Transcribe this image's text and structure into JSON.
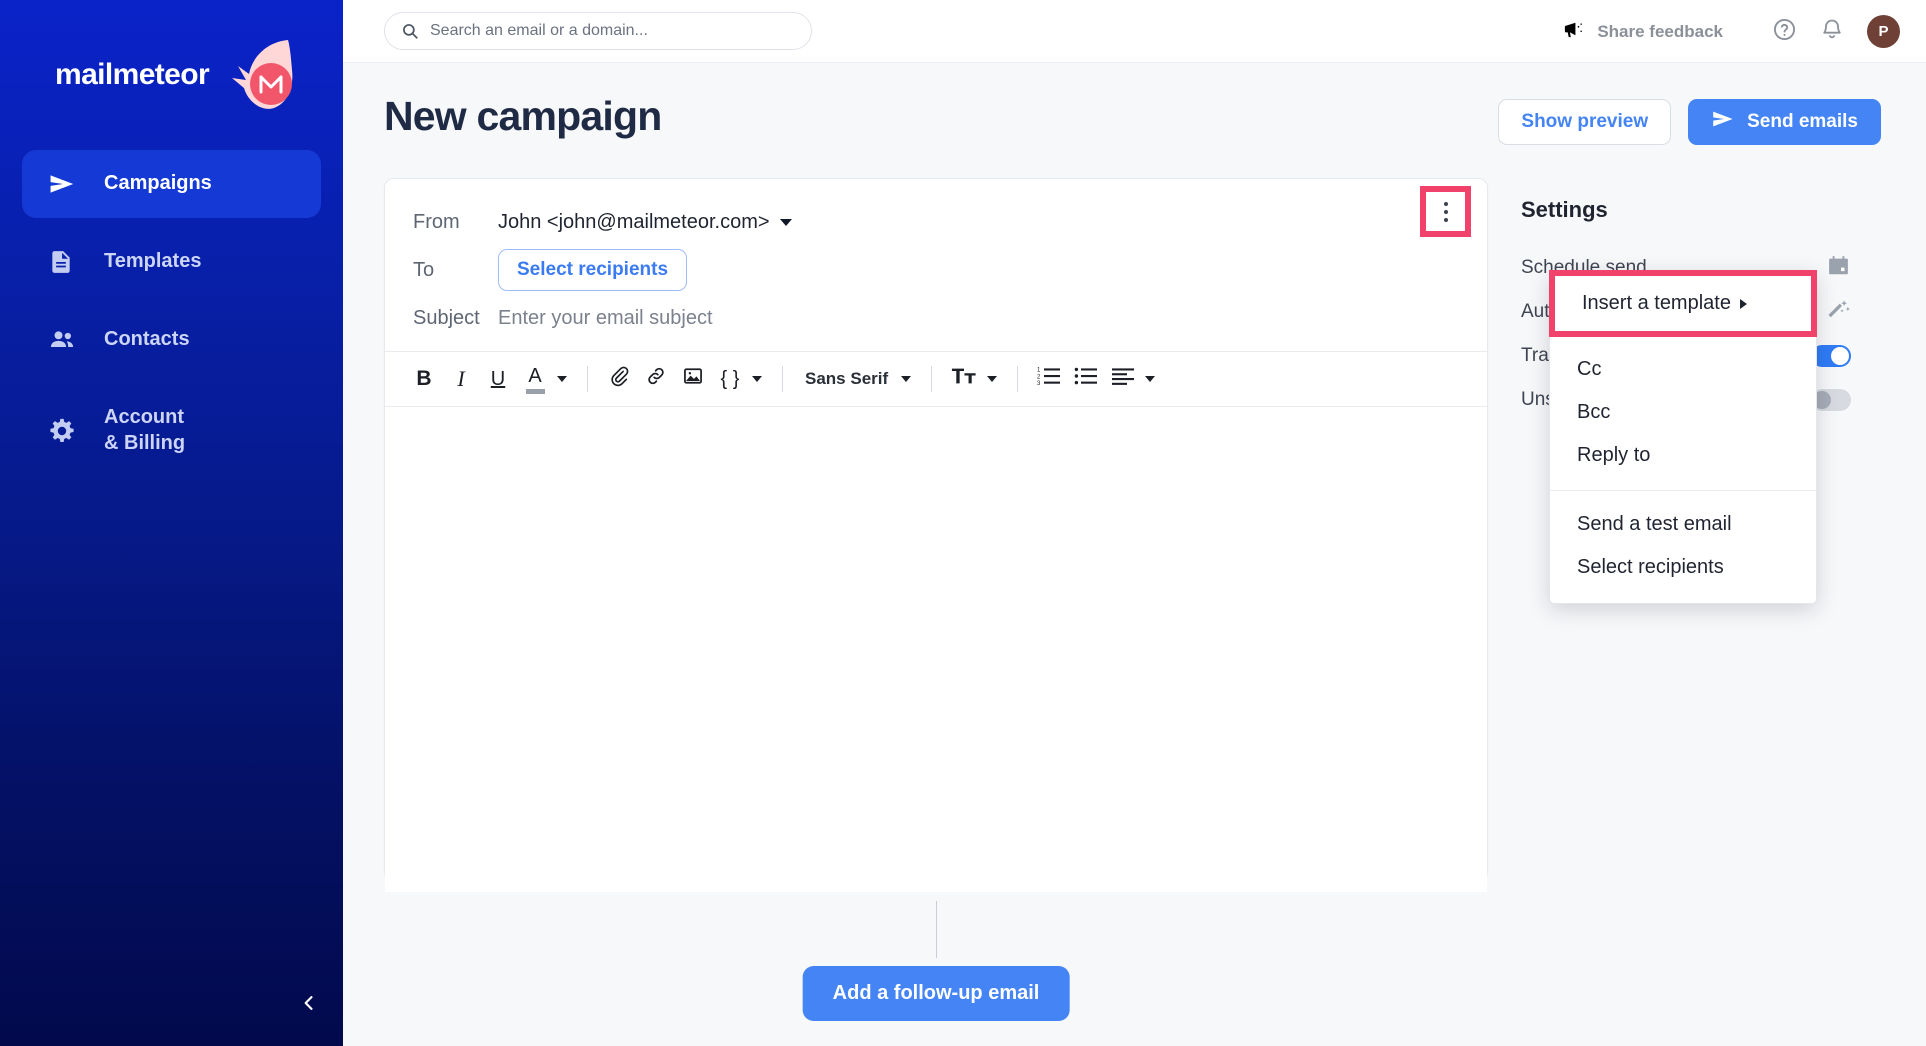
{
  "brand": {
    "name": "mailmeteor",
    "logo_icon": "meteor-icon",
    "accent_blue": "#4484f4",
    "sidebar_top": "#0a23c9",
    "sidebar_bottom": "#020a4c",
    "highlight_pink": "#f0426b"
  },
  "sidebar": {
    "items": [
      {
        "label": "Campaigns",
        "icon": "send-icon",
        "active": true
      },
      {
        "label": "Templates",
        "icon": "document-icon",
        "active": false
      },
      {
        "label": "Contacts",
        "icon": "people-icon",
        "active": false
      },
      {
        "label": "Account\n& Billing",
        "icon": "gear-icon",
        "active": false
      }
    ],
    "collapse_icon": "chevron-left-icon"
  },
  "topbar": {
    "search": {
      "placeholder": "Search an email or a domain...",
      "value": "",
      "icon": "search-icon"
    },
    "feedback_label": "Share feedback",
    "feedback_icon": "megaphone-icon",
    "help_icon": "help-circle-icon",
    "notifications_icon": "bell-icon",
    "avatar_initial": "P"
  },
  "page": {
    "title": "New campaign",
    "show_preview_label": "Show preview",
    "send_emails_label": "Send emails",
    "send_icon": "send-icon"
  },
  "compose": {
    "from_label": "From",
    "from_value": "John <john@mailmeteor.com>",
    "to_label": "To",
    "to_button_label": "Select recipients",
    "subject_label": "Subject",
    "subject_placeholder": "Enter your email subject",
    "subject_value": "",
    "body_value": "",
    "kebab_icon": "more-vertical-icon",
    "toolbar": {
      "bold": "B",
      "italic": "I",
      "underline": "U",
      "text_color": "A",
      "attach_icon": "paperclip-icon",
      "link_icon": "link-icon",
      "image_icon": "image-icon",
      "merge_tag": "{ }",
      "font_family": "Sans Serif",
      "font_size_icon": "text-size-icon",
      "numbered_list_icon": "numbered-list-icon",
      "bulleted_list_icon": "bulleted-list-icon",
      "align_icon": "align-left-icon"
    }
  },
  "menu": {
    "items": [
      {
        "label": "Insert a template",
        "has_submenu": true,
        "highlighted": true
      },
      {
        "label": "Cc",
        "has_submenu": false,
        "highlighted": false
      },
      {
        "label": "Bcc",
        "has_submenu": false,
        "highlighted": false
      },
      {
        "label": "Reply to",
        "has_submenu": false,
        "highlighted": false
      },
      {
        "label": "Send a test email",
        "has_submenu": false,
        "highlighted": false
      },
      {
        "label": "Select recipients",
        "has_submenu": false,
        "highlighted": false
      }
    ]
  },
  "followup": {
    "button_label": "Add a follow-up email"
  },
  "settings": {
    "title": "Settings",
    "rows": [
      {
        "label": "Schedule send",
        "info": false,
        "control": "icon",
        "icon": "calendar-icon"
      },
      {
        "label": "Autopilot",
        "info": true,
        "control": "icon",
        "icon": "magic-wand-icon"
      },
      {
        "label": "Track emails",
        "info": true,
        "control": "toggle",
        "on": true
      },
      {
        "label": "Unsubscribe link",
        "info": true,
        "control": "toggle",
        "on": false
      }
    ]
  }
}
